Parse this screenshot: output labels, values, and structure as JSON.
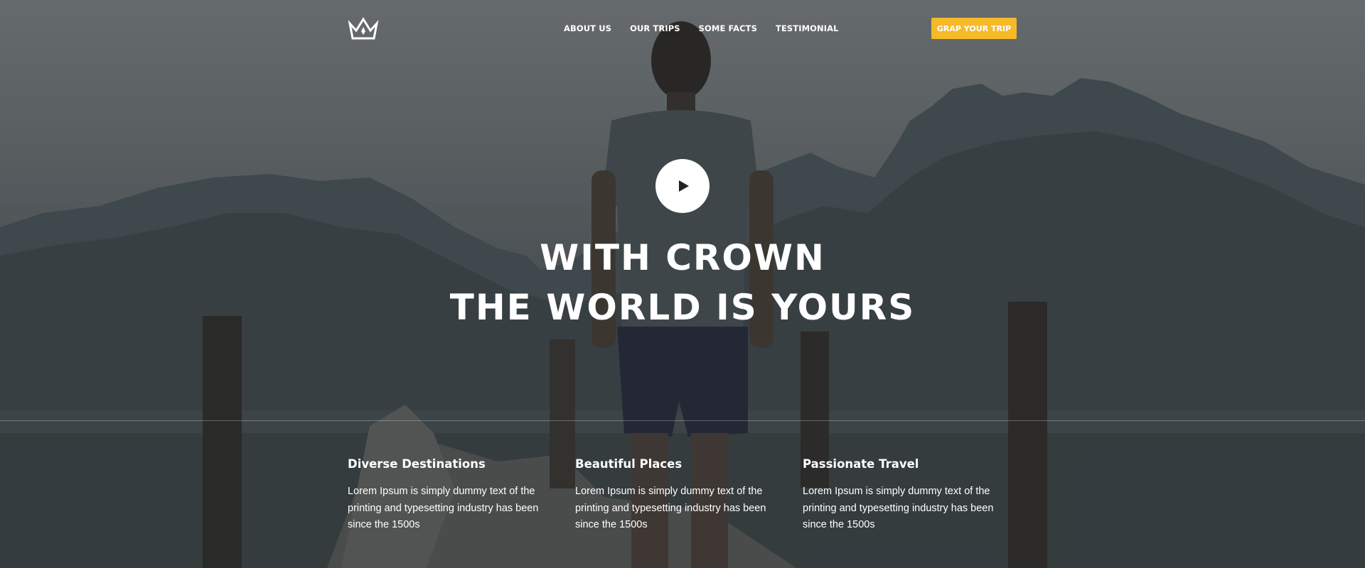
{
  "nav": {
    "logo_icon": "crown-icon",
    "items": [
      {
        "label": "ABOUT US"
      },
      {
        "label": "OUR TRIPS"
      },
      {
        "label": "SOME FACTS"
      },
      {
        "label": "TESTIMONIAL"
      }
    ],
    "cta_label": "GRAP YOUR TRIP"
  },
  "hero": {
    "play_icon": "play-icon",
    "headline_line1": "WITH CROWN",
    "headline_line2": "THE WORLD IS YOURS"
  },
  "features": [
    {
      "title": "Diverse Destinations",
      "text": "Lorem Ipsum is simply dummy text of the printing and typesetting industry has been since the 1500s"
    },
    {
      "title": "Beautiful Places",
      "text": "Lorem Ipsum is simply dummy text of the printing and typesetting industry has been since the 1500s"
    },
    {
      "title": "Passionate Travel",
      "text": "Lorem Ipsum is simply dummy text of the printing and typesetting industry has been since the 1500s"
    }
  ],
  "colors": {
    "accent": "#f6b928",
    "text": "#ffffff"
  }
}
